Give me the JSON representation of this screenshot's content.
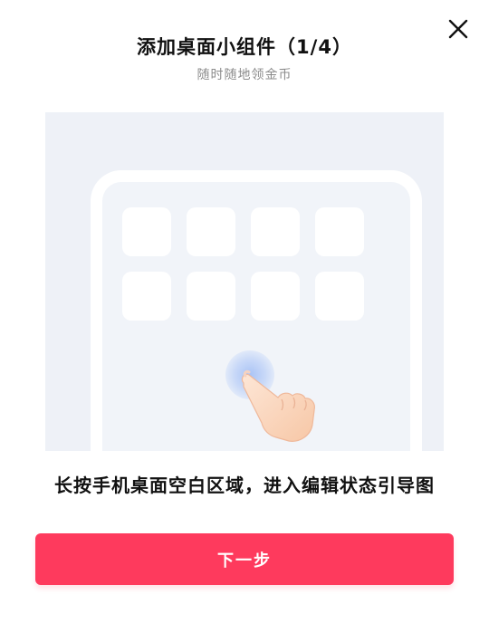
{
  "dialog": {
    "title": "添加桌面小组件（1/4）",
    "subtitle": "随时随地领金币",
    "close_icon": "close-icon"
  },
  "illustration": {
    "app_icon_count": 8,
    "pointer_icon": "hand-pointer-icon"
  },
  "instruction": "长按手机桌面空白区域，进入编辑状态引导图",
  "buttons": {
    "next_label": "下一步"
  },
  "colors": {
    "accent": "#fe3a5d",
    "illustration_bg": "#eef1f7",
    "subtitle": "#8c8c8c"
  }
}
